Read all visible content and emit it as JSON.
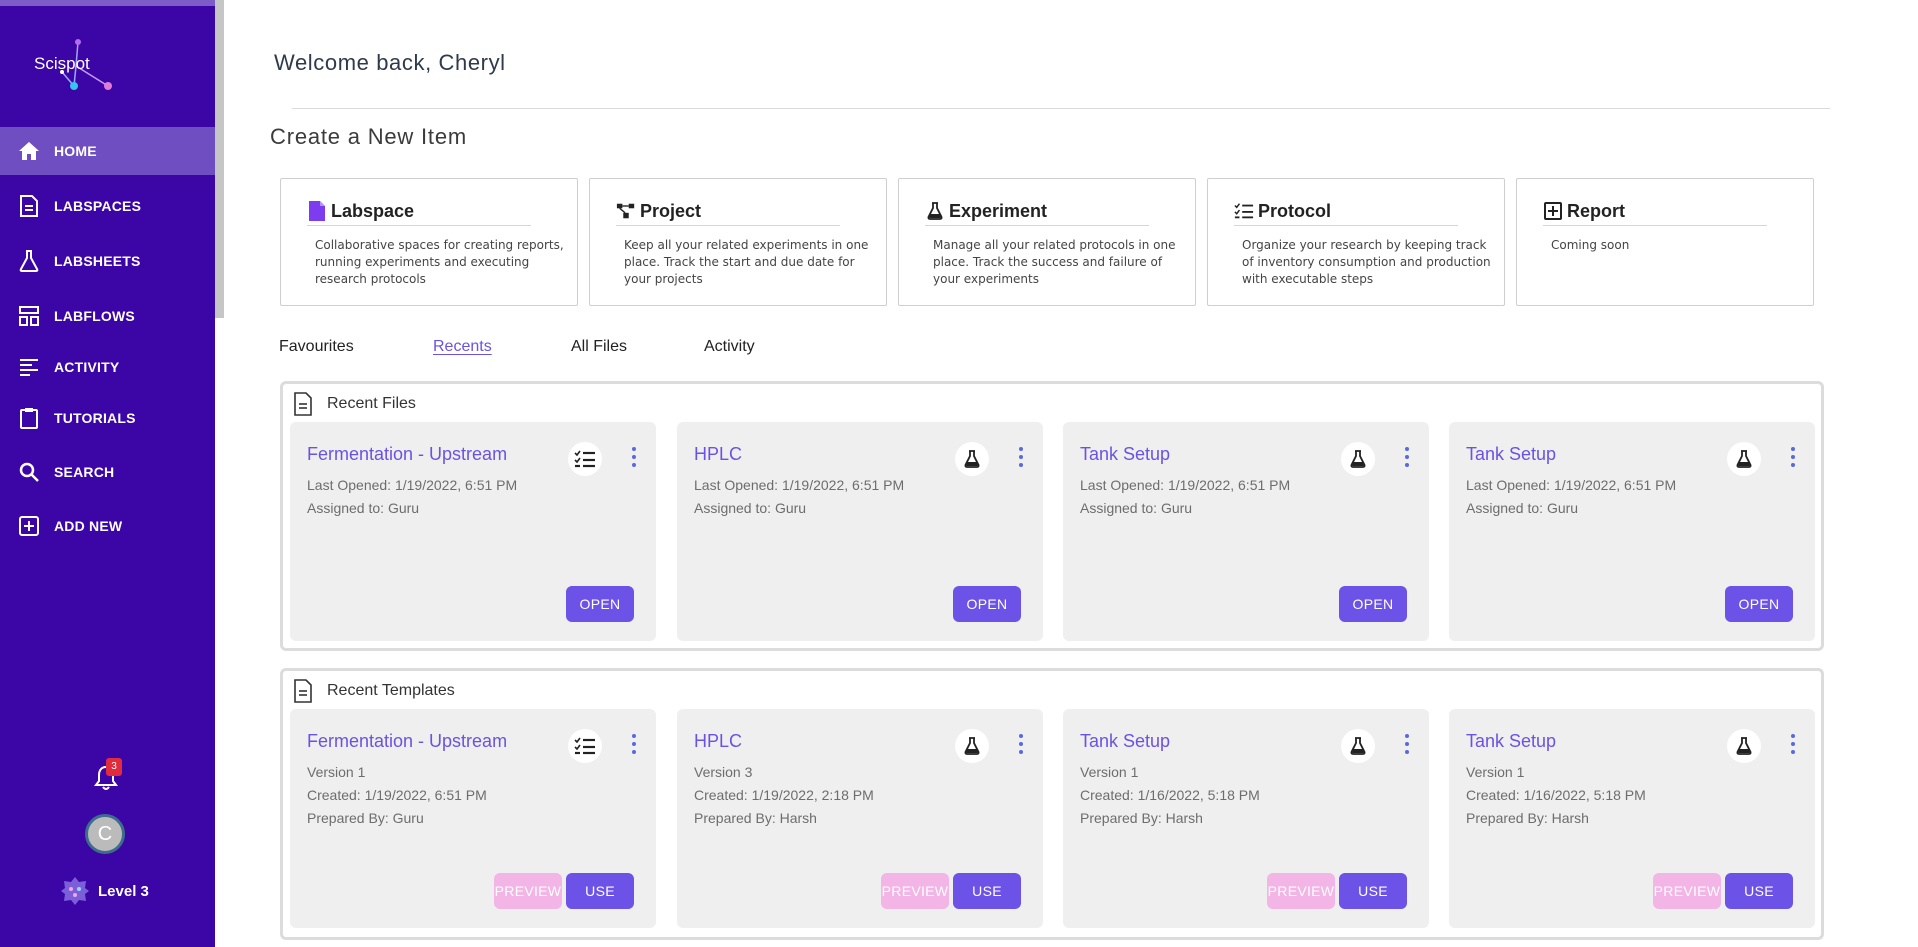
{
  "sidebar": {
    "logo": "Scispot",
    "items": [
      {
        "label": "HOME",
        "icon": "home-icon"
      },
      {
        "label": "LABSPACES",
        "icon": "document-icon"
      },
      {
        "label": "LABSHEETS",
        "icon": "flask-icon"
      },
      {
        "label": "LABFLOWS",
        "icon": "layout-icon"
      },
      {
        "label": "ACTIVITY",
        "icon": "lines-icon"
      },
      {
        "label": "TUTORIALS",
        "icon": "clipboard-icon"
      },
      {
        "label": "SEARCH",
        "icon": "search-icon"
      },
      {
        "label": "ADD NEW",
        "icon": "plus-square-icon"
      }
    ],
    "notification_count": "3",
    "avatar_initial": "C",
    "level": "Level 3"
  },
  "header": {
    "welcome": "Welcome back, Cheryl",
    "create_title": "Create a New Item"
  },
  "create_items": [
    {
      "title": "Labspace",
      "desc": "Collaborative spaces for creating reports, running experiments and executing research protocols"
    },
    {
      "title": "Project",
      "desc": "Keep all your related experiments in one place. Track the start and due date for your projects"
    },
    {
      "title": "Experiment",
      "desc": "Manage all your related protocols in one place. Track the success and failure of your experiments"
    },
    {
      "title": "Protocol",
      "desc": "Organize your research by keeping track of inventory consumption and production with executable steps"
    },
    {
      "title": "Report",
      "desc": "Coming soon"
    }
  ],
  "tabs": [
    "Favourites",
    "Recents",
    "All Files",
    "Activity"
  ],
  "recent_files": {
    "title": "Recent Files",
    "cards": [
      {
        "title": "Fermentation - Upstream",
        "type_icon": "checklist-icon",
        "line1": "Last Opened: 1/19/2022, 6:51 PM",
        "line2": "Assigned to: Guru",
        "button": "OPEN"
      },
      {
        "title": "HPLC",
        "type_icon": "flask-icon",
        "line1": "Last Opened: 1/19/2022, 6:51 PM",
        "line2": "Assigned to: Guru",
        "button": "OPEN"
      },
      {
        "title": "Tank Setup",
        "type_icon": "flask-icon",
        "line1": "Last Opened: 1/19/2022, 6:51 PM",
        "line2": "Assigned to: Guru",
        "button": "OPEN"
      },
      {
        "title": "Tank Setup",
        "type_icon": "flask-icon",
        "line1": "Last Opened: 1/19/2022, 6:51 PM",
        "line2": "Assigned to: Guru",
        "button": "OPEN"
      }
    ]
  },
  "recent_templates": {
    "title": "Recent Templates",
    "cards": [
      {
        "title": "Fermentation - Upstream",
        "type_icon": "checklist-icon",
        "line1": "Version 1",
        "line2": "Created: 1/19/2022, 6:51 PM",
        "line3": "Prepared By: Guru",
        "preview": "PREVIEW",
        "button": "USE"
      },
      {
        "title": "HPLC",
        "type_icon": "flask-icon",
        "line1": "Version 3",
        "line2": "Created: 1/19/2022, 2:18 PM",
        "line3": "Prepared By: Harsh",
        "preview": "PREVIEW",
        "button": "USE"
      },
      {
        "title": "Tank Setup",
        "type_icon": "flask-icon",
        "line1": "Version 1",
        "line2": "Created: 1/16/2022, 5:18 PM",
        "line3": "Prepared By: Harsh",
        "preview": "PREVIEW",
        "button": "USE"
      },
      {
        "title": "Tank Setup",
        "type_icon": "flask-icon",
        "line1": "Version 1",
        "line2": "Created: 1/16/2022, 5:18 PM",
        "line3": "Prepared By: Harsh",
        "preview": "PREVIEW",
        "button": "USE"
      }
    ]
  },
  "colors": {
    "sidebar": "#3c05a6",
    "sidebar_active": "#6f4ec2",
    "accent": "#6c52e6",
    "preview": "#f3b4e6",
    "card_bg": "#efefef"
  }
}
